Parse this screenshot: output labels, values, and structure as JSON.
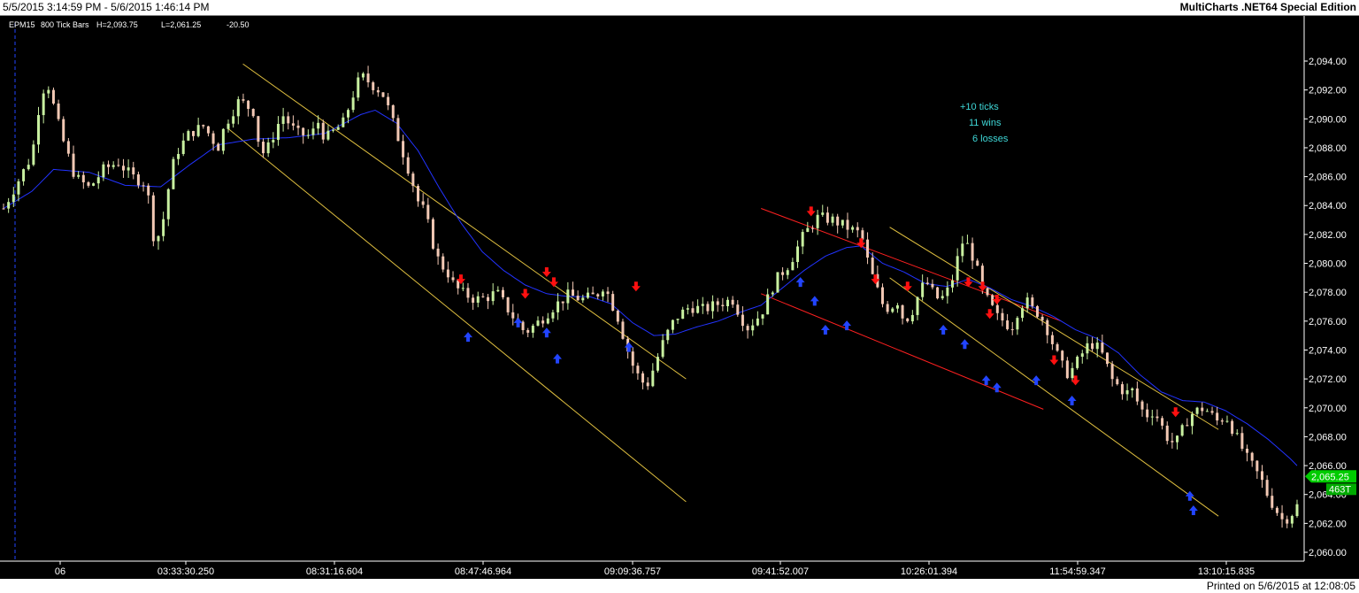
{
  "window": {
    "range_title": "5/5/2015 3:14:59 PM - 5/6/2015 1:46:14 PM",
    "app_title": "MultiCharts .NET64 Special Edition",
    "printed": "Printed on 5/6/2015 at 12:08:05"
  },
  "symbol": {
    "name": "EPM15",
    "bars": "800 Tick Bars",
    "high": "H=2,093.75",
    "low": "L=2,061.25",
    "change": "-20.50"
  },
  "annotations": {
    "line1": "+10 ticks",
    "line2": "11 wins",
    "line3": "6 losses"
  },
  "price_markers": {
    "last": "2,065.25",
    "tick_count": "463T"
  },
  "colors": {
    "background": "#000000",
    "up_candle": "#c8f0a0",
    "down_candle": "#f2c8b4",
    "moving_average": "#2233ff",
    "channel_yellow": "#e0c040",
    "channel_red": "#ff2020",
    "buy_arrow": "#2244ff",
    "sell_arrow": "#ff1010",
    "last_price_marker": "#00cc00"
  },
  "chart_data": {
    "type": "candlestick",
    "title": "",
    "y_range": [
      2060,
      2095
    ],
    "y_ticks": [
      "2,094.00",
      "2,092.00",
      "2,090.00",
      "2,088.00",
      "2,086.00",
      "2,084.00",
      "2,082.00",
      "2,080.00",
      "2,078.00",
      "2,076.00",
      "2,074.00",
      "2,072.00",
      "2,070.00",
      "2,068.00",
      "2,066.00",
      "2,064.00",
      "2,062.00",
      "2,060.00"
    ],
    "y_tick_values": [
      2094,
      2092,
      2090,
      2088,
      2086,
      2084,
      2082,
      2080,
      2078,
      2076,
      2074,
      2072,
      2070,
      2068,
      2066,
      2064,
      2062,
      2060
    ],
    "x_labels": [
      "06",
      "03:33:30.250",
      "08:31:16.604",
      "08:47:46.964",
      "09:09:36.757",
      "09:41:52.007",
      "10:26:01.394",
      "11:54:59.347",
      "13:10:15.835"
    ],
    "bar_count": 260,
    "price_path": [
      [
        0,
        2083.8
      ],
      [
        3,
        2085.2
      ],
      [
        8,
        2087.5
      ],
      [
        10,
        2091.0
      ],
      [
        12,
        2092.8
      ],
      [
        16,
        2089.0
      ],
      [
        20,
        2086.0
      ],
      [
        24,
        2085.2
      ],
      [
        28,
        2086.5
      ],
      [
        32,
        2087.0
      ],
      [
        36,
        2086.0
      ],
      [
        40,
        2085.5
      ],
      [
        42,
        2081.8
      ],
      [
        44,
        2082.0
      ],
      [
        46,
        2085.0
      ],
      [
        48,
        2087.5
      ],
      [
        52,
        2089.0
      ],
      [
        56,
        2089.5
      ],
      [
        60,
        2088.0
      ],
      [
        62,
        2089.6
      ],
      [
        66,
        2091.3
      ],
      [
        70,
        2090.5
      ],
      [
        72,
        2087.5
      ],
      [
        74,
        2088.0
      ],
      [
        78,
        2090.3
      ],
      [
        82,
        2089.0
      ],
      [
        86,
        2088.8
      ],
      [
        88,
        2089.8
      ],
      [
        90,
        2088.6
      ],
      [
        95,
        2089.7
      ],
      [
        98,
        2091.8
      ],
      [
        100,
        2093.0
      ],
      [
        104,
        2092.2
      ],
      [
        106,
        2091.8
      ],
      [
        108,
        2090.5
      ],
      [
        110,
        2089.0
      ],
      [
        112,
        2087.5
      ],
      [
        114,
        2086.0
      ],
      [
        116,
        2084.3
      ],
      [
        118,
        2083.5
      ],
      [
        120,
        2081.5
      ],
      [
        122,
        2080.0
      ],
      [
        124,
        2079.5
      ],
      [
        126,
        2078.5
      ],
      [
        128,
        2078.0
      ],
      [
        132,
        2077.5
      ],
      [
        135,
        2077.6
      ],
      [
        138,
        2078.0
      ],
      [
        142,
        2076.5
      ],
      [
        146,
        2075.2
      ],
      [
        150,
        2076.0
      ],
      [
        154,
        2077.0
      ],
      [
        158,
        2077.8
      ],
      [
        162,
        2077.5
      ],
      [
        166,
        2077.8
      ],
      [
        168,
        2078.5
      ],
      [
        172,
        2076.2
      ],
      [
        174,
        2074.5
      ],
      [
        176,
        2073.0
      ],
      [
        178,
        2072.0
      ],
      [
        180,
        2071.5
      ],
      [
        182,
        2072.8
      ],
      [
        185,
        2074.8
      ],
      [
        188,
        2076.2
      ],
      [
        192,
        2077.0
      ],
      [
        196,
        2076.8
      ],
      [
        200,
        2077.2
      ],
      [
        204,
        2077.5
      ],
      [
        208,
        2075.5
      ],
      [
        212,
        2076.5
      ],
      [
        216,
        2078.8
      ],
      [
        220,
        2080.0
      ],
      [
        224,
        2082.0
      ],
      [
        228,
        2083.2
      ],
      [
        232,
        2083.0
      ],
      [
        236,
        2082.5
      ],
      [
        240,
        2082.0
      ],
      [
        242,
        2080.0
      ],
      [
        244,
        2078.5
      ],
      [
        246,
        2077.2
      ],
      [
        248,
        2076.8
      ],
      [
        250,
        2077.5
      ],
      [
        252,
        2076.0
      ],
      [
        254,
        2076.5
      ],
      [
        256,
        2077.8
      ],
      [
        258,
        2078.8
      ],
      [
        260,
        2078.0
      ],
      [
        262,
        2077.4
      ],
      [
        264,
        2078.0
      ],
      [
        266,
        2079.2
      ],
      [
        268,
        2081.5
      ],
      [
        270,
        2081.2
      ],
      [
        272,
        2080.0
      ],
      [
        274,
        2078.0
      ],
      [
        276,
        2077.2
      ],
      [
        278,
        2076.3
      ],
      [
        280,
        2076.0
      ],
      [
        282,
        2075.5
      ],
      [
        284,
        2076.8
      ],
      [
        286,
        2077.5
      ],
      [
        288,
        2076.8
      ],
      [
        290,
        2076.5
      ],
      [
        292,
        2075.5
      ],
      [
        294,
        2074.2
      ],
      [
        296,
        2073.0
      ],
      [
        298,
        2072.3
      ],
      [
        300,
        2073.0
      ],
      [
        302,
        2073.8
      ],
      [
        304,
        2074.5
      ],
      [
        306,
        2074.2
      ],
      [
        308,
        2073.5
      ],
      [
        310,
        2072.0
      ],
      [
        312,
        2071.5
      ],
      [
        314,
        2071.0
      ],
      [
        316,
        2071.2
      ],
      [
        318,
        2070.0
      ],
      [
        320,
        2069.5
      ],
      [
        322,
        2069.8
      ],
      [
        324,
        2068.8
      ],
      [
        326,
        2067.8
      ],
      [
        328,
        2067.5
      ],
      [
        330,
        2068.5
      ],
      [
        332,
        2069.5
      ],
      [
        334,
        2069.8
      ],
      [
        336,
        2070.0
      ],
      [
        338,
        2069.5
      ],
      [
        340,
        2069.0
      ],
      [
        342,
        2069.5
      ],
      [
        344,
        2068.5
      ],
      [
        346,
        2067.5
      ],
      [
        348,
        2066.5
      ],
      [
        350,
        2065.8
      ],
      [
        352,
        2065.0
      ],
      [
        354,
        2063.8
      ],
      [
        356,
        2063.0
      ],
      [
        358,
        2062.2
      ],
      [
        360,
        2062.5
      ],
      [
        362,
        2063.2
      ]
    ],
    "moving_average_path": [
      [
        0,
        2083.8
      ],
      [
        8,
        2085.0
      ],
      [
        14,
        2086.5
      ],
      [
        24,
        2086.3
      ],
      [
        34,
        2085.4
      ],
      [
        44,
        2085.3
      ],
      [
        52,
        2086.8
      ],
      [
        60,
        2088.2
      ],
      [
        70,
        2088.6
      ],
      [
        80,
        2088.7
      ],
      [
        90,
        2089.0
      ],
      [
        100,
        2090.3
      ],
      [
        104,
        2090.6
      ],
      [
        110,
        2089.7
      ],
      [
        116,
        2087.8
      ],
      [
        122,
        2085.2
      ],
      [
        128,
        2082.8
      ],
      [
        134,
        2080.8
      ],
      [
        140,
        2079.5
      ],
      [
        146,
        2078.5
      ],
      [
        152,
        2077.9
      ],
      [
        158,
        2077.7
      ],
      [
        164,
        2077.7
      ],
      [
        170,
        2077.2
      ],
      [
        176,
        2075.9
      ],
      [
        182,
        2075.0
      ],
      [
        188,
        2075.1
      ],
      [
        194,
        2075.6
      ],
      [
        200,
        2076.0
      ],
      [
        206,
        2076.6
      ],
      [
        212,
        2077.1
      ],
      [
        218,
        2078.3
      ],
      [
        224,
        2079.5
      ],
      [
        230,
        2080.5
      ],
      [
        236,
        2081.1
      ],
      [
        240,
        2081.2
      ],
      [
        246,
        2080.0
      ],
      [
        252,
        2079.4
      ],
      [
        258,
        2078.6
      ],
      [
        264,
        2078.4
      ],
      [
        270,
        2078.9
      ],
      [
        276,
        2078.3
      ],
      [
        282,
        2077.5
      ],
      [
        288,
        2077.0
      ],
      [
        294,
        2076.3
      ],
      [
        300,
        2075.4
      ],
      [
        306,
        2074.8
      ],
      [
        312,
        2073.8
      ],
      [
        318,
        2072.3
      ],
      [
        324,
        2071.1
      ],
      [
        330,
        2070.5
      ],
      [
        336,
        2070.4
      ],
      [
        342,
        2069.8
      ],
      [
        348,
        2068.9
      ],
      [
        354,
        2067.8
      ],
      [
        360,
        2066.5
      ],
      [
        362,
        2066.0
      ]
    ],
    "channels": [
      {
        "color": "yellow",
        "points": [
          [
            67,
            2093.8
          ],
          [
            191,
            2072.0
          ]
        ]
      },
      {
        "color": "yellow",
        "points": [
          [
            63,
            2089.3
          ],
          [
            191,
            2063.5
          ]
        ]
      },
      {
        "color": "red",
        "points": [
          [
            212,
            2083.8
          ],
          [
            296,
            2076.0
          ]
        ]
      },
      {
        "color": "red",
        "points": [
          [
            212,
            2077.9
          ],
          [
            291,
            2069.9
          ]
        ]
      },
      {
        "color": "yellow",
        "points": [
          [
            248,
            2082.5
          ],
          [
            340,
            2068.5
          ]
        ]
      },
      {
        "color": "yellow",
        "points": [
          [
            248,
            2079.0
          ],
          [
            340,
            2062.5
          ]
        ]
      }
    ],
    "sell_signals": [
      [
        128,
        2078.8
      ],
      [
        146,
        2077.8
      ],
      [
        152,
        2079.3
      ],
      [
        154,
        2078.6
      ],
      [
        177,
        2078.3
      ],
      [
        226,
        2083.5
      ],
      [
        240,
        2081.3
      ],
      [
        244,
        2078.8
      ],
      [
        253,
        2078.3
      ],
      [
        270,
        2078.6
      ],
      [
        274,
        2078.3
      ],
      [
        278,
        2077.4
      ],
      [
        276,
        2076.4
      ],
      [
        294,
        2073.2
      ],
      [
        300,
        2071.8
      ],
      [
        328,
        2069.6
      ]
    ],
    "buy_signals": [
      [
        130,
        2075.0
      ],
      [
        144,
        2076.0
      ],
      [
        152,
        2075.3
      ],
      [
        155,
        2073.5
      ],
      [
        175,
        2074.3
      ],
      [
        223,
        2078.8
      ],
      [
        227,
        2077.5
      ],
      [
        230,
        2075.5
      ],
      [
        236,
        2075.8
      ],
      [
        263,
        2075.5
      ],
      [
        269,
        2074.5
      ],
      [
        275,
        2072.0
      ],
      [
        278,
        2071.5
      ],
      [
        289,
        2072.0
      ],
      [
        299,
        2070.6
      ],
      [
        332,
        2064.0
      ],
      [
        333,
        2063.0
      ]
    ]
  }
}
